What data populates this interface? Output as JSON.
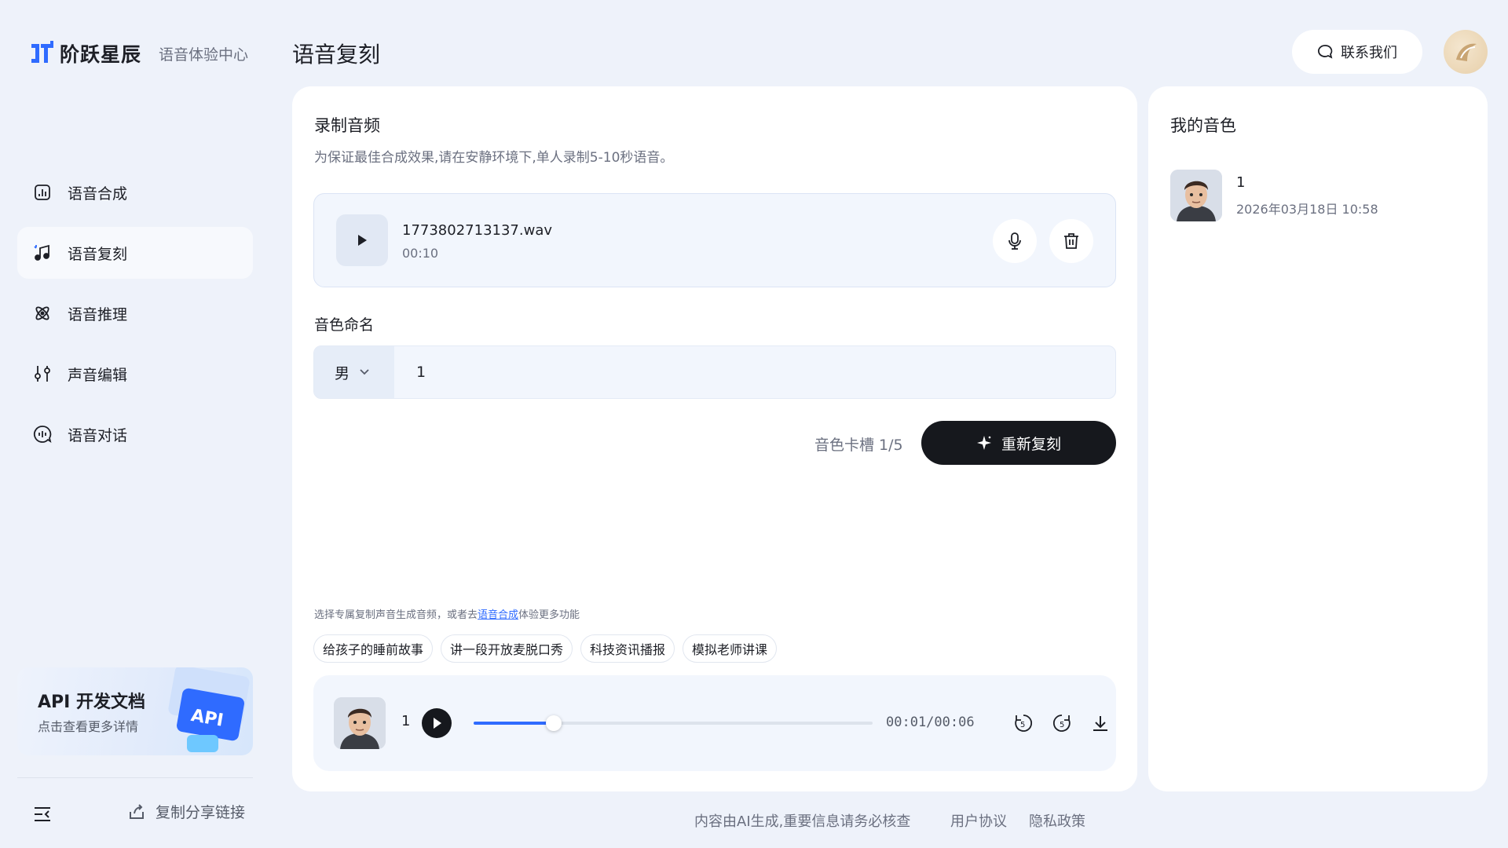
{
  "brand": {
    "name": "阶跃星辰",
    "subtitle": "语音体验中心"
  },
  "nav": {
    "items": [
      {
        "label": "语音合成",
        "icon": "speech-synthesis-icon",
        "active": false
      },
      {
        "label": "语音复刻",
        "icon": "music-note-icon",
        "active": true
      },
      {
        "label": "语音推理",
        "icon": "atom-icon",
        "active": false
      },
      {
        "label": "声音编辑",
        "icon": "sliders-icon",
        "active": false
      },
      {
        "label": "语音对话",
        "icon": "voice-chat-icon",
        "active": false
      }
    ]
  },
  "api_card": {
    "title": "API 开发文档",
    "subtitle": "点击查看更多详情"
  },
  "sidebar_footer": {
    "share_label": "复制分享链接"
  },
  "header": {
    "title": "语音复刻",
    "contact_label": "联系我们"
  },
  "record": {
    "title": "录制音频",
    "description": "为保证最佳合成效果,请在安静环境下,单人录制5-10秒语音。",
    "file_name": "1773802713137.wav",
    "duration": "00:10"
  },
  "naming": {
    "label": "音色命名",
    "gender": "男",
    "name_value": "1"
  },
  "actions": {
    "slot_text": "音色卡槽 1/5",
    "reclone_label": "重新复刻"
  },
  "suggestions": {
    "hint_prefix": "选择专属复制声音生成音频，或者去",
    "hint_link": "语音合成",
    "hint_suffix": "体验更多功能",
    "chips": [
      "给孩子的睡前故事",
      "讲一段开放麦脱口秀",
      "科技资讯播报",
      "模拟老师讲课"
    ]
  },
  "player": {
    "voice_name": "1",
    "time": "00:01/00:06",
    "progress": 0.2
  },
  "my_voices": {
    "title": "我的音色",
    "items": [
      {
        "name": "1",
        "date": "2026年03月18日 10:58"
      }
    ]
  },
  "footer": {
    "disclaimer": "内容由AI生成,重要信息请务必核查",
    "terms": "用户协议",
    "privacy": "隐私政策"
  },
  "colors": {
    "accent": "#2f6bff",
    "primary_button": "#16181d",
    "background": "#eef2fa"
  }
}
